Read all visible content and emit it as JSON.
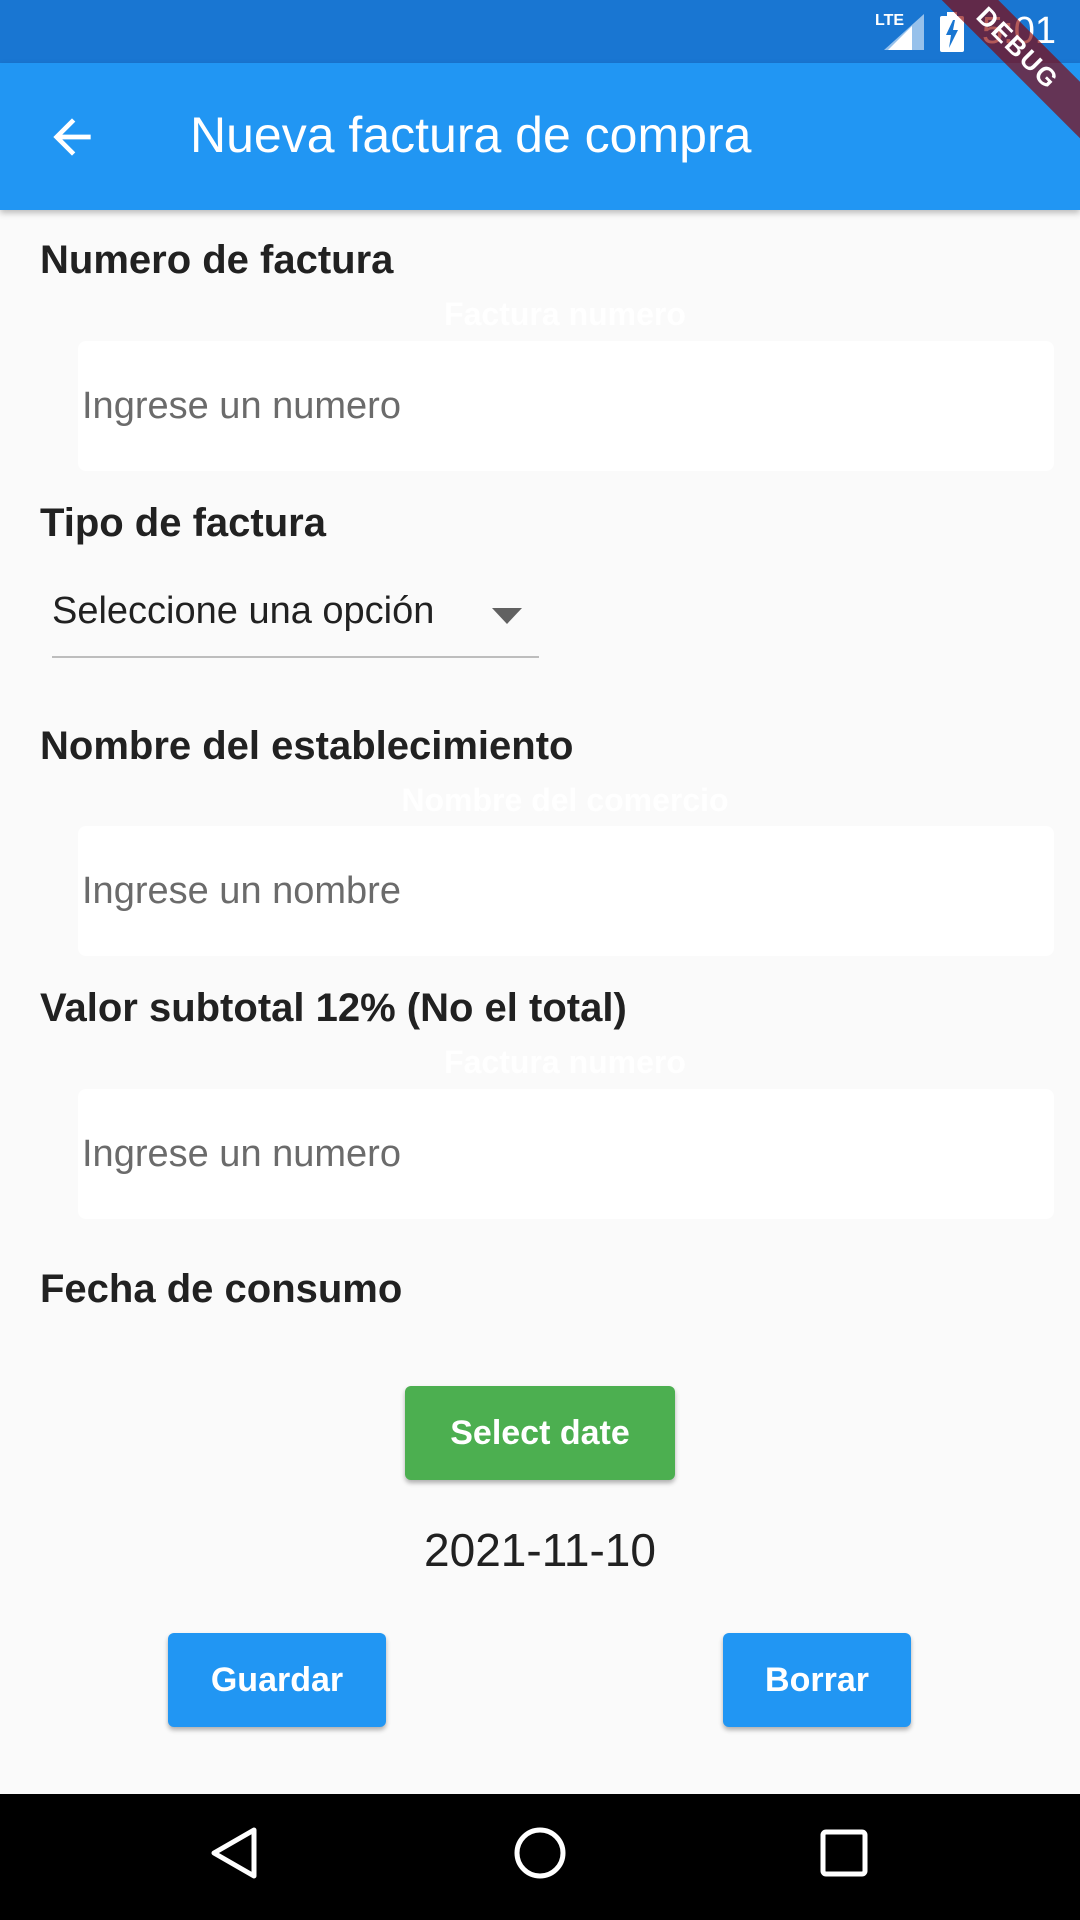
{
  "status_bar": {
    "time": "5:01",
    "network": "LTE",
    "icons": [
      "signal-icon",
      "battery-charging-icon"
    ]
  },
  "debug_banner": "DEBUG",
  "app_bar": {
    "title": "Nueva factura de compra",
    "back_icon": "arrow-back-icon"
  },
  "form": {
    "invoice_number": {
      "label": "Numero de factura",
      "ghost_label": "Factura numero",
      "placeholder": "Ingrese un numero",
      "value": ""
    },
    "invoice_type": {
      "label": "Tipo de factura",
      "selected": "Seleccione una opción"
    },
    "establishment": {
      "label": "Nombre del establecimiento",
      "ghost_label": "Nombre del comercio",
      "placeholder": "Ingrese un nombre",
      "value": ""
    },
    "subtotal": {
      "label": "Valor subtotal 12% (No el total)",
      "ghost_label": "Factura numero",
      "placeholder": "Ingrese un numero",
      "value": ""
    },
    "consumption_date": {
      "label": "Fecha de consumo",
      "select_button": "Select date",
      "value": "2021-11-10"
    }
  },
  "actions": {
    "save": "Guardar",
    "clear": "Borrar"
  },
  "colors": {
    "status_bar": "#1976d2",
    "app_bar": "#2196f3",
    "select_date_button": "#4caf50",
    "action_buttons": "#2196f3",
    "background": "#fafafa"
  },
  "nav_bar": {
    "icons": [
      "nav-back-icon",
      "nav-home-icon",
      "nav-recents-icon"
    ]
  }
}
